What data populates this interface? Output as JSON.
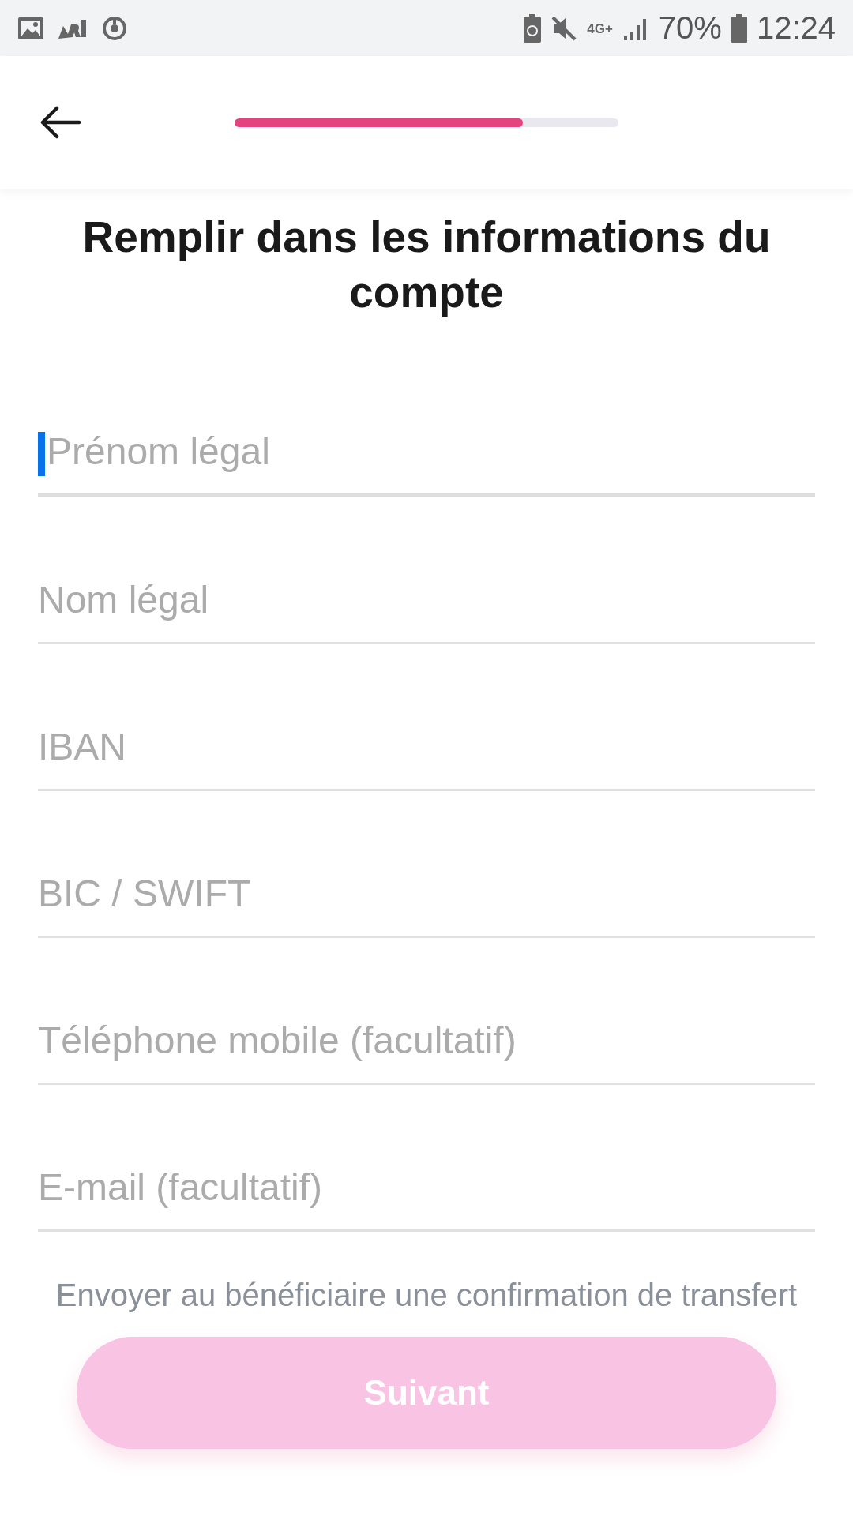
{
  "status_bar": {
    "network": "4G+",
    "battery": "70%",
    "time": "12:24"
  },
  "header": {
    "progress": {
      "level": 0.75
    }
  },
  "title": "Remplir dans les informations du compte",
  "fields": [
    {
      "placeholder": "Prénom légal",
      "focused": true
    },
    {
      "placeholder": "Nom légal",
      "focused": false
    },
    {
      "placeholder": "IBAN",
      "focused": false
    },
    {
      "placeholder": "BIC / SWIFT",
      "focused": false
    },
    {
      "placeholder": "Téléphone mobile (facultatif)",
      "focused": false
    },
    {
      "placeholder": "E-mail (facultatif)",
      "focused": false
    }
  ],
  "hint": "Envoyer au bénéficiaire une confirmation de transfert",
  "button": {
    "label": "Suivant",
    "disabled": true
  }
}
